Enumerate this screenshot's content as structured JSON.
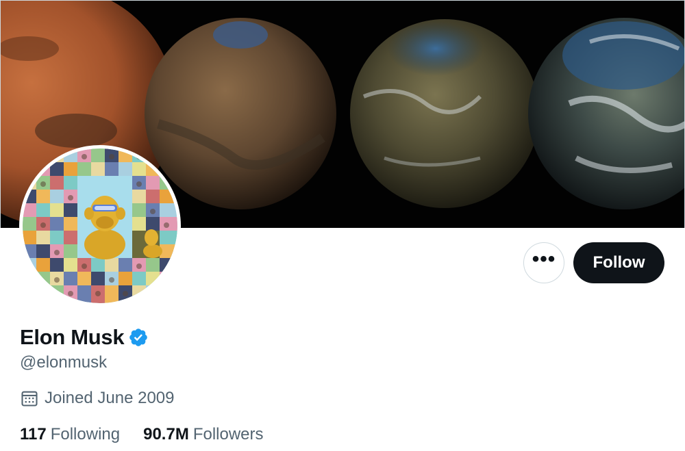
{
  "profile": {
    "name": "Elon Musk",
    "handle": "@elonmusk",
    "joined": "Joined June 2009",
    "verified": true
  },
  "actions": {
    "more_label": "•••",
    "follow_label": "Follow"
  },
  "stats": {
    "following_count": "117",
    "following_label": "Following",
    "followers_count": "90.7M",
    "followers_label": "Followers"
  },
  "icons": {
    "verified": "verified-badge-icon",
    "calendar": "calendar-icon",
    "more": "more-dots-icon"
  },
  "colors": {
    "text_primary": "#0f1419",
    "text_secondary": "#536471",
    "verified_blue": "#1d9bf0",
    "follow_bg": "#0f1419",
    "border": "#cfd9de"
  }
}
